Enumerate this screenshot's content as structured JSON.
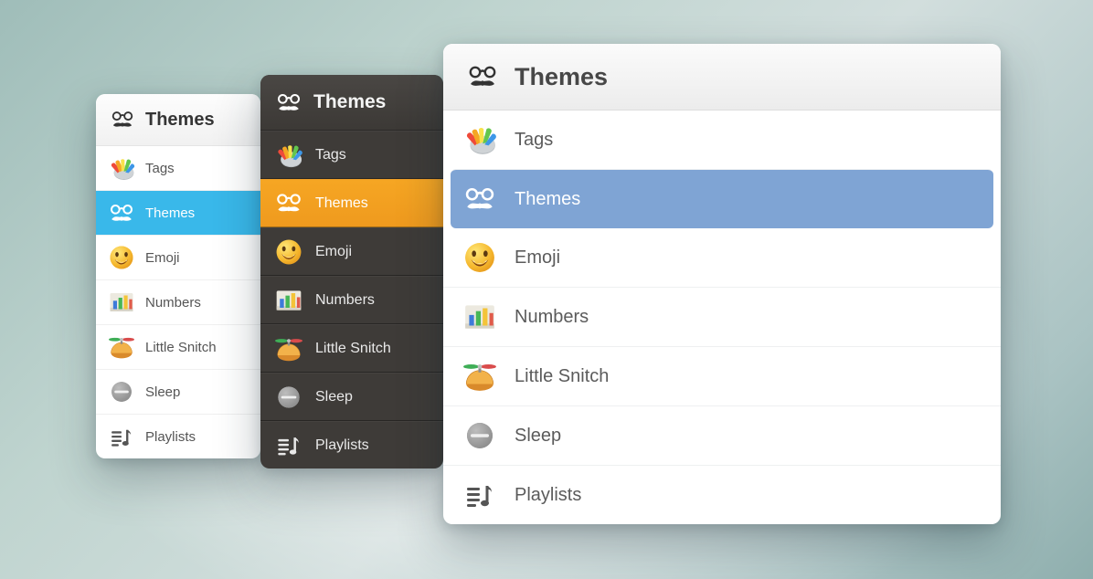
{
  "title": "Themes",
  "panels": [
    {
      "id": "pA",
      "variant": "light-small",
      "selection_color": "#39b8ea"
    },
    {
      "id": "pB",
      "variant": "dark",
      "selection_color": "#f5a623"
    },
    {
      "id": "pC",
      "variant": "light-large",
      "selection_color": "#7fa4d4",
      "show_chevrons": true
    }
  ],
  "items": [
    {
      "icon": "tags-icon",
      "label": "Tags",
      "selected": false
    },
    {
      "icon": "themes-icon",
      "label": "Themes",
      "selected": true
    },
    {
      "icon": "emoji-icon",
      "label": "Emoji",
      "selected": false
    },
    {
      "icon": "numbers-icon",
      "label": "Numbers",
      "selected": false
    },
    {
      "icon": "littlesnitch-icon",
      "label": "Little Snitch",
      "selected": false
    },
    {
      "icon": "sleep-icon",
      "label": "Sleep",
      "selected": false
    },
    {
      "icon": "playlists-icon",
      "label": "Playlists",
      "selected": false
    }
  ]
}
